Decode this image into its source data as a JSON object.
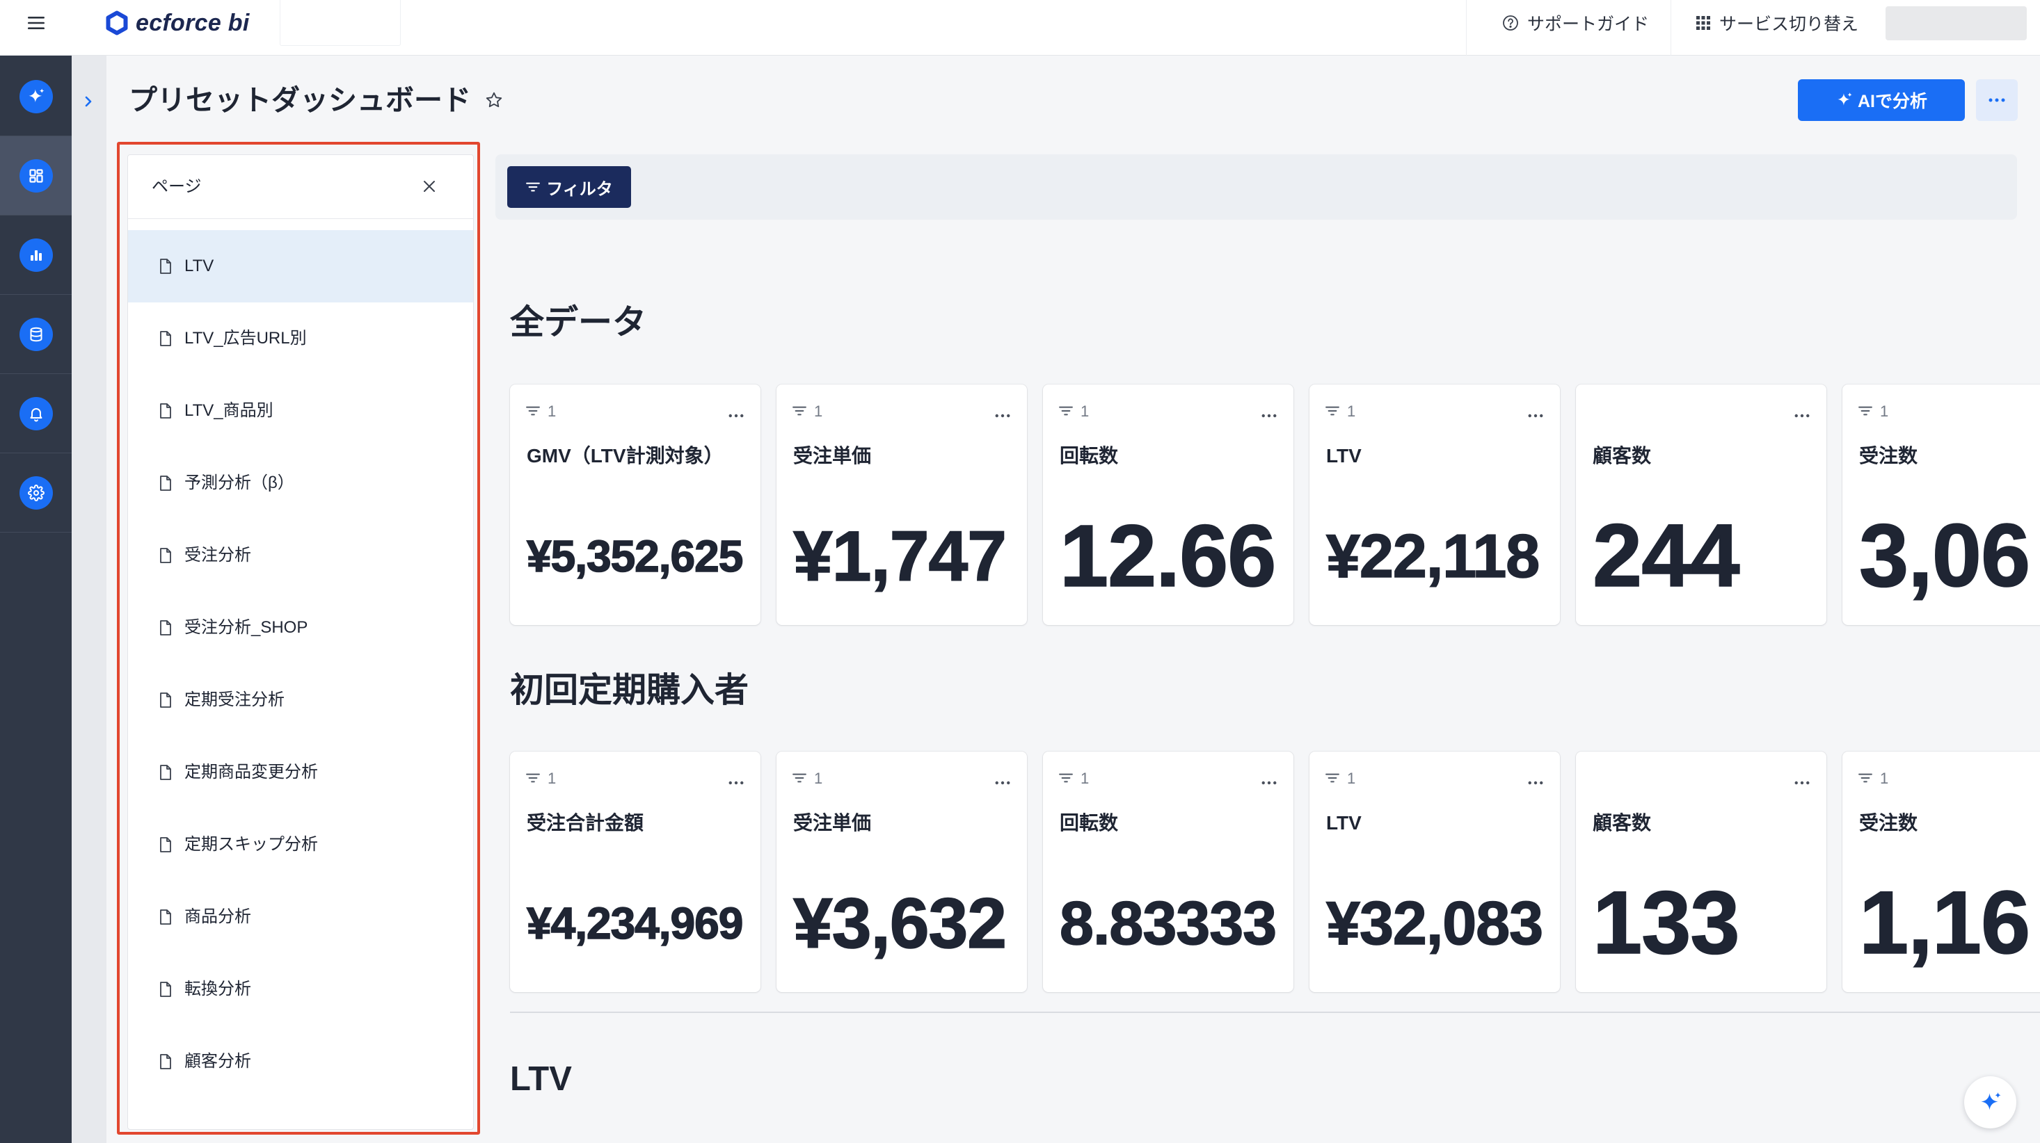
{
  "header": {
    "brand": "ecforce bi",
    "support_label": "サポートガイド",
    "switch_label": "サービス切り替え",
    "icons": {
      "menu": "menu-icon",
      "logo": "ecforce-logo-icon",
      "support": "question-circle-icon",
      "switch": "grid-icon"
    }
  },
  "sidebar": {
    "items": [
      {
        "icon": "sparkle-icon",
        "active": false
      },
      {
        "icon": "dashboard-icon",
        "active": true
      },
      {
        "icon": "bar-chart-icon",
        "active": false
      },
      {
        "icon": "database-icon",
        "active": false
      },
      {
        "icon": "bell-icon",
        "active": false
      },
      {
        "icon": "gear-icon",
        "active": false
      }
    ],
    "expand_icon": "chevron-right-icon"
  },
  "page": {
    "title": "プリセットダッシュボード",
    "ai_button_label": "AIで分析"
  },
  "pages_panel": {
    "title": "ページ",
    "selected_index": 0,
    "items": [
      "LTV",
      "LTV_広告URL別",
      "LTV_商品別",
      "予測分析（β）",
      "受注分析",
      "受注分析_SHOP",
      "定期受注分析",
      "定期商品変更分析",
      "定期スキップ分析",
      "商品分析",
      "転換分析",
      "顧客分析"
    ]
  },
  "filter_bar": {
    "button_label": "フィルタ"
  },
  "sections": [
    {
      "title": "全データ",
      "cards": [
        {
          "filter_count": "1",
          "label": "GMV（LTV計測対象）",
          "value": "¥5,352,625"
        },
        {
          "filter_count": "1",
          "label": "受注単価",
          "value": "¥1,747"
        },
        {
          "filter_count": "1",
          "label": "回転数",
          "value": "12.66"
        },
        {
          "filter_count": "1",
          "label": "LTV",
          "value": "¥22,118"
        },
        {
          "filter_count": null,
          "label": "顧客数",
          "value": "244"
        },
        {
          "filter_count": "1",
          "label": "受注数",
          "value": "3,06"
        }
      ]
    },
    {
      "title": "初回定期購入者",
      "cards": [
        {
          "filter_count": "1",
          "label": "受注合計金額",
          "value": "¥4,234,969"
        },
        {
          "filter_count": "1",
          "label": "受注単価",
          "value": "¥3,632"
        },
        {
          "filter_count": "1",
          "label": "回転数",
          "value": "8.83333"
        },
        {
          "filter_count": "1",
          "label": "LTV",
          "value": "¥32,083"
        },
        {
          "filter_count": null,
          "label": "顧客数",
          "value": "133"
        },
        {
          "filter_count": "1",
          "label": "受注数",
          "value": "1,16"
        }
      ]
    },
    {
      "title": "LTV",
      "cards": []
    }
  ],
  "colors": {
    "accent": "#1a6ef5",
    "sidebar": "#303847",
    "sidebar_active": "#4a5366",
    "filter_button": "#1b2b5d",
    "highlight_frame": "#e2472f",
    "selected_page": "#e4eef9"
  }
}
